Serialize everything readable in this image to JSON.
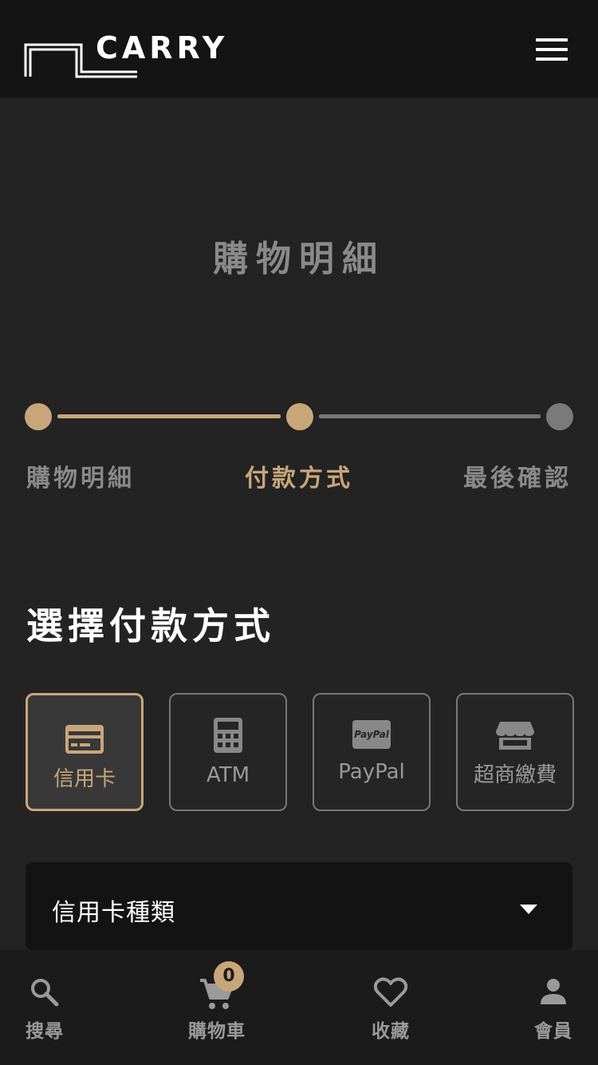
{
  "header": {
    "brand": "CARRY",
    "menu_icon": "hamburger-menu-icon"
  },
  "page_title": "購物明細",
  "steps": [
    {
      "label": "購物明細",
      "state": "done"
    },
    {
      "label": "付款方式",
      "state": "active"
    },
    {
      "label": "最後確認",
      "state": "todo"
    }
  ],
  "section_title": "選擇付款方式",
  "methods": [
    {
      "label": "信用卡",
      "icon": "credit-card-icon",
      "selected": true
    },
    {
      "label": "ATM",
      "icon": "calculator-icon",
      "selected": false
    },
    {
      "label": "PayPal",
      "icon": "paypal-icon",
      "icon_text": "PayPal",
      "selected": false
    },
    {
      "label": "超商繳費",
      "icon": "store-icon",
      "selected": false
    }
  ],
  "card_type_select": {
    "value": "信用卡種類",
    "icon": "dropdown-arrow-icon"
  },
  "bottom_nav": {
    "search": {
      "label": "搜尋",
      "icon": "search-icon"
    },
    "cart": {
      "label": "購物車",
      "icon": "cart-icon",
      "badge": "0"
    },
    "favorites": {
      "label": "收藏",
      "icon": "heart-icon"
    },
    "member": {
      "label": "會員",
      "icon": "person-icon"
    }
  },
  "colors": {
    "accent": "#c9a679",
    "background": "#232323",
    "header": "#141414",
    "muted": "#8a8a8a"
  }
}
